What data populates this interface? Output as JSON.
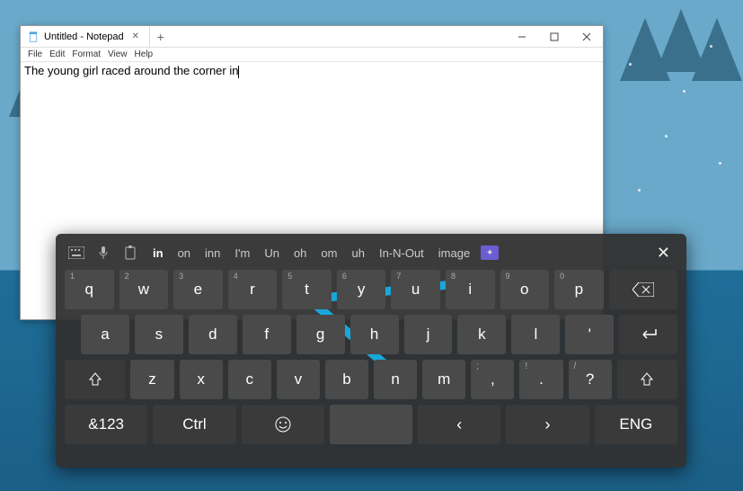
{
  "window": {
    "title": "Untitled - Notepad",
    "menus": [
      "File",
      "Edit",
      "Format",
      "View",
      "Help"
    ],
    "text": "The young girl raced around the corner in"
  },
  "keyboard": {
    "suggestions": [
      "in",
      "on",
      "inn",
      "I'm",
      "Un",
      "oh",
      "om",
      "uh",
      "In-N-Out",
      "image"
    ],
    "selected_suggestion_index": 0,
    "row1": [
      {
        "k": "q",
        "n": "1"
      },
      {
        "k": "w",
        "n": "2"
      },
      {
        "k": "e",
        "n": "3"
      },
      {
        "k": "r",
        "n": "4"
      },
      {
        "k": "t",
        "n": "5"
      },
      {
        "k": "y",
        "n": "6"
      },
      {
        "k": "u",
        "n": "7"
      },
      {
        "k": "i",
        "n": "8"
      },
      {
        "k": "o",
        "n": "9"
      },
      {
        "k": "p",
        "n": "0"
      }
    ],
    "row2": [
      {
        "k": "a"
      },
      {
        "k": "s"
      },
      {
        "k": "d"
      },
      {
        "k": "f"
      },
      {
        "k": "g"
      },
      {
        "k": "h"
      },
      {
        "k": "j"
      },
      {
        "k": "k"
      },
      {
        "k": "l"
      },
      {
        "k": "'"
      }
    ],
    "row3": [
      {
        "k": "z"
      },
      {
        "k": "x"
      },
      {
        "k": "c"
      },
      {
        "k": "v"
      },
      {
        "k": "b"
      },
      {
        "k": "n"
      },
      {
        "k": "m"
      },
      {
        "k": ",",
        "alt": ";"
      },
      {
        "k": ".",
        "alt": "!"
      },
      {
        "k": "?",
        "alt": "/"
      }
    ],
    "bottom": {
      "symbols": "&123",
      "ctrl": "Ctrl",
      "lang": "ENG"
    }
  }
}
